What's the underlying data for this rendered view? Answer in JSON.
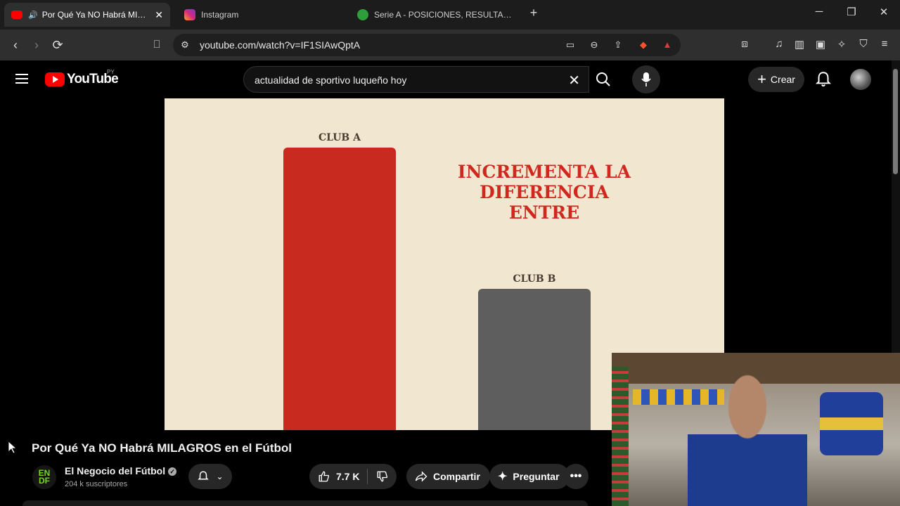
{
  "browser": {
    "tabs": [
      {
        "title": "Por Qué Ya NO Habrá MILAGR",
        "icon": "youtube-icon"
      },
      {
        "title": "Instagram",
        "icon": "instagram-icon"
      },
      {
        "title": "Serie A - POSICIONES, RESULTADOS D",
        "icon": "soccer-ball-icon"
      }
    ],
    "new_tab": "+",
    "url": "youtube.com/watch?v=IF1SIAwQptA"
  },
  "youtube": {
    "logo_text": "YouTube",
    "region": "PY",
    "search_query": "actualidad de sportivo luqueño hoy",
    "create_label": "Crear"
  },
  "video_frame": {
    "headline": "INCREMENTA LA DIFERENCIA ENTRE",
    "bars": [
      {
        "label": "CLUB A",
        "color": "#c92a20"
      },
      {
        "label": "CLUB B",
        "color": "#5e5e5e"
      }
    ]
  },
  "video": {
    "title": "Por Qué Ya NO Habrá MILAGROS en el Fútbol",
    "channel_avatar_text": "EN DF",
    "channel_name": "El Negocio del Fútbol",
    "subscribers": "204 k suscriptores",
    "likes": "7.7 K",
    "share_label": "Compartir",
    "ask_label": "Preguntar"
  }
}
